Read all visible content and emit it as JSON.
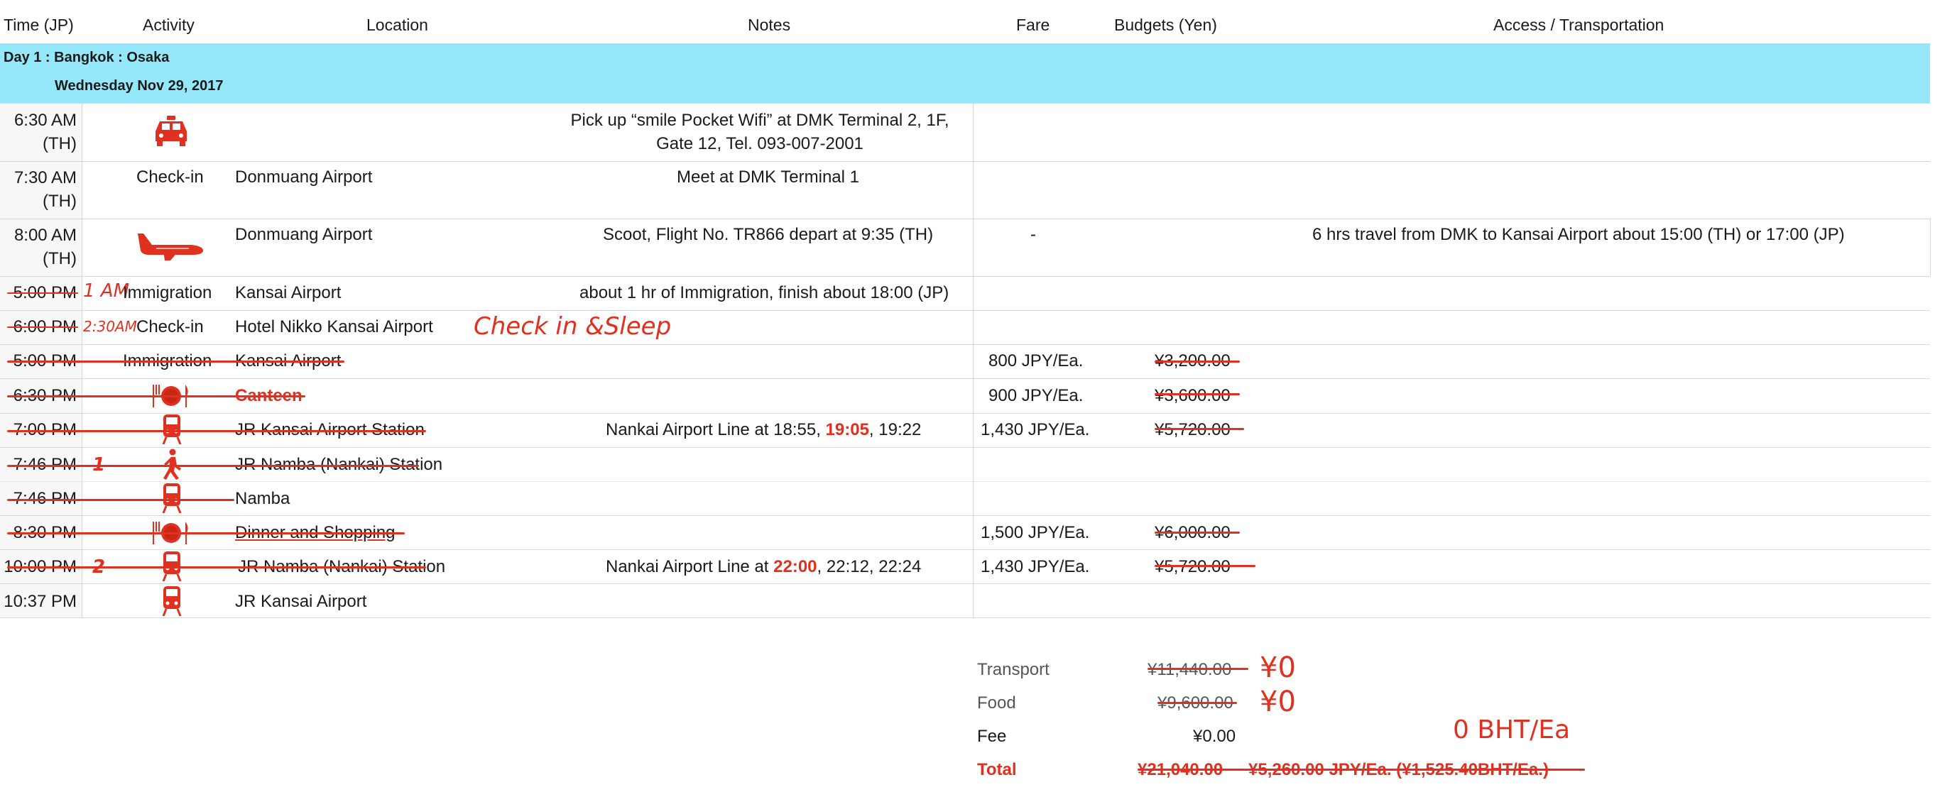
{
  "header": {
    "time": "Time (JP)",
    "activity": "Activity",
    "location": "Location",
    "notes": "Notes",
    "fare": "Fare",
    "budgets": "Budgets (Yen)",
    "access": "Access / Transportation"
  },
  "day": {
    "title": "Day 1 : Bangkok : Osaka",
    "date": "Wednesday Nov 29, 2017"
  },
  "rows": [
    {
      "time_a": "6:30 AM",
      "time_b": "(TH)",
      "activity_icon": "taxi-icon",
      "location": "",
      "notes_a": "Pick up “smile Pocket Wifi” at DMK Terminal 2, 1F,",
      "notes_b": "Gate 12, Tel. 093-007-2001"
    },
    {
      "time_a": "7:30 AM",
      "time_b": "(TH)",
      "activity": "Check-in",
      "location": "Donmuang Airport",
      "notes": "Meet at DMK Terminal 1"
    },
    {
      "time_a": "8:00 AM",
      "time_b": "(TH)",
      "activity_icon": "airplane-icon",
      "location": "Donmuang Airport",
      "notes": "Scoot, Flight No. TR866 depart at 9:35 (TH)",
      "fare": "-",
      "access": "6 hrs travel from DMK to Kansai Airport about 15:00 (TH) or 17:00 (JP)"
    },
    {
      "time": "5:00 PM",
      "mark": "1 AM",
      "activity": "Immigration",
      "location": "Kansai Airport",
      "notes": "about 1 hr of Immigration, finish about 18:00 (JP)"
    },
    {
      "time": "6:00 PM",
      "mark": "2:30AM",
      "activity": "Check-in",
      "location": "Hotel Nikko Kansai Airport",
      "notes_hand": "Check in &Sleep"
    },
    {
      "time": "5:00 PM",
      "activity": "Immigration",
      "location": "Kansai Airport",
      "fare": "800 JPY/Ea.",
      "budget": "¥3,200.00"
    },
    {
      "time": "6:30 PM",
      "activity_icon": "restaurant-icon",
      "location": "Canteen",
      "fare": "900 JPY/Ea.",
      "budget": "¥3,600.00"
    },
    {
      "time": "7:00 PM",
      "activity_icon": "train-icon",
      "location": "JR Kansai Airport Station",
      "notes_pre": "Nankai Airport Line at 18:55, ",
      "notes_hl": "19:05",
      "notes_post": ", 19:22",
      "fare": "1,430 JPY/Ea.",
      "budget": "¥5,720.00"
    },
    {
      "time": "7:46 PM",
      "mark": "1",
      "activity_icon": "walking-icon",
      "location": "JR Namba (Nankai) Station"
    },
    {
      "time": "7:46 PM",
      "activity_icon": "train-icon",
      "location": "Namba"
    },
    {
      "time": "8:30 PM",
      "activity_icon": "restaurant-icon",
      "location": "Dinner and Shopping",
      "fare": "1,500 JPY/Ea.",
      "budget": "¥6,000.00"
    },
    {
      "time": "10:00 PM",
      "mark": "2",
      "activity_icon": "train-icon",
      "location": "JR Namba (Nankai) Station",
      "notes_pre": "Nankai Airport Line at ",
      "notes_hl": "22:00",
      "notes_post": ", 22:12, 22:24",
      "fare": "1,430 JPY/Ea.",
      "budget": "¥5,720.00"
    },
    {
      "time": "10:37 PM",
      "activity_icon": "train-icon",
      "location": "JR Kansai Airport"
    }
  ],
  "summary": {
    "transport_label": "Transport",
    "transport_value": "¥11,440.00",
    "transport_hand": "¥0",
    "food_label": "Food",
    "food_value": "¥9,600.00",
    "food_hand": "¥0",
    "fee_label": "Fee",
    "fee_value": "¥0.00",
    "total_label": "Total",
    "total_value": "¥21,040.00",
    "total_detail": "¥5,260.00 JPY/Ea. (¥1,525.40BHT/Ea.)",
    "bht_hand": "0 BHT/Ea"
  },
  "colors": {
    "band": "#94e8fa",
    "accent_red": "#e0301f",
    "grid_line": "#d8d8d8"
  }
}
